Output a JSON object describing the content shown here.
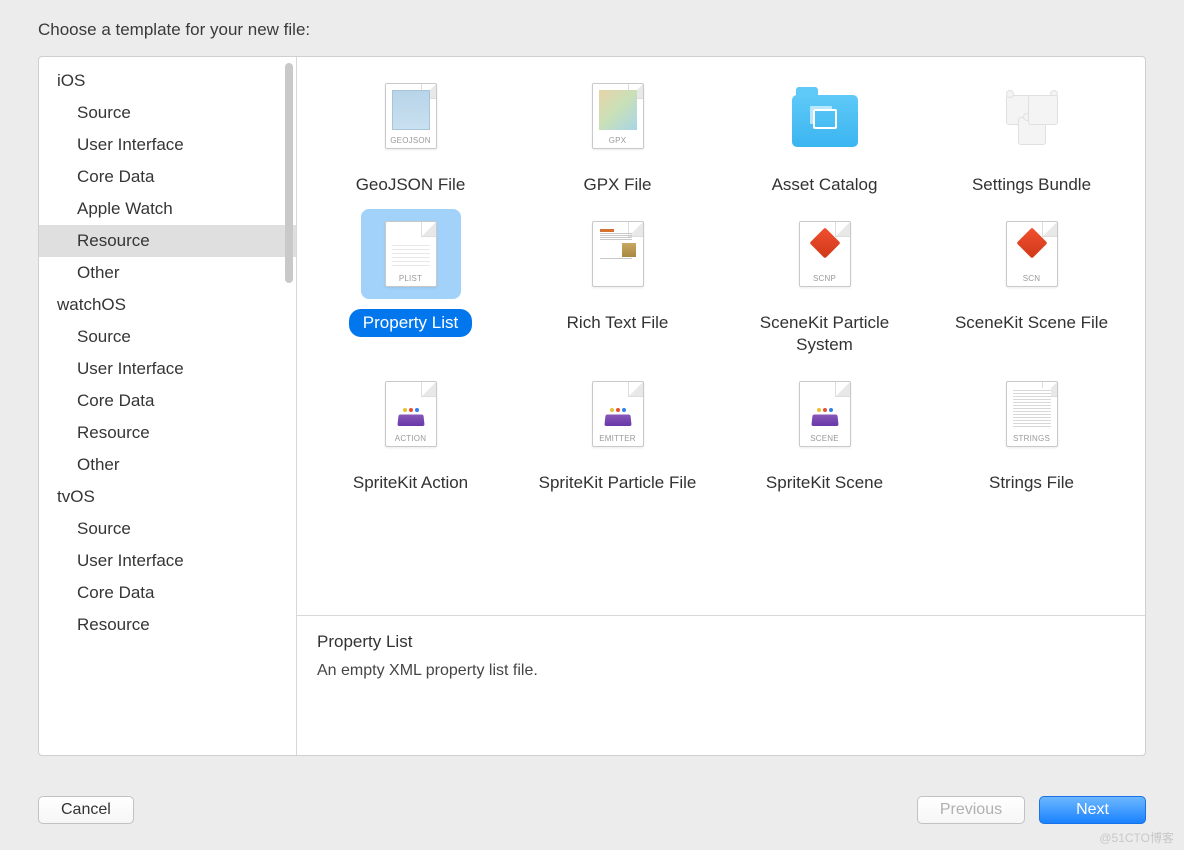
{
  "title": "Choose a template for your new file:",
  "sidebar": [
    {
      "type": "head",
      "label": "iOS"
    },
    {
      "type": "item",
      "label": "Source"
    },
    {
      "type": "item",
      "label": "User Interface"
    },
    {
      "type": "item",
      "label": "Core Data"
    },
    {
      "type": "item",
      "label": "Apple Watch"
    },
    {
      "type": "item",
      "label": "Resource",
      "selected": true
    },
    {
      "type": "item",
      "label": "Other"
    },
    {
      "type": "head",
      "label": "watchOS"
    },
    {
      "type": "item",
      "label": "Source"
    },
    {
      "type": "item",
      "label": "User Interface"
    },
    {
      "type": "item",
      "label": "Core Data"
    },
    {
      "type": "item",
      "label": "Resource"
    },
    {
      "type": "item",
      "label": "Other"
    },
    {
      "type": "head",
      "label": "tvOS"
    },
    {
      "type": "item",
      "label": "Source"
    },
    {
      "type": "item",
      "label": "User Interface"
    },
    {
      "type": "item",
      "label": "Core Data"
    },
    {
      "type": "item",
      "label": "Resource"
    }
  ],
  "templates": {
    "r0": [
      {
        "label": "GeoJSON File",
        "tag": "GEOJSON",
        "icon": "geo"
      },
      {
        "label": "GPX File",
        "tag": "GPX",
        "icon": "gpx"
      },
      {
        "label": "Asset Catalog",
        "icon": "folder"
      },
      {
        "label": "Settings Bundle",
        "icon": "lego"
      }
    ],
    "r1": [
      {
        "label": "Property List",
        "tag": "PLIST",
        "icon": "plist",
        "selected": true
      },
      {
        "label": "Rich Text File",
        "icon": "rtf"
      },
      {
        "label": "SceneKit Particle System",
        "tag": "SCNP",
        "icon": "scn"
      },
      {
        "label": "SceneKit Scene File",
        "tag": "SCN",
        "icon": "scn"
      }
    ],
    "r2": [
      {
        "label": "SpriteKit Action",
        "tag": "ACTION",
        "icon": "sk"
      },
      {
        "label": "SpriteKit Particle File",
        "tag": "EMITTER",
        "icon": "sk"
      },
      {
        "label": "SpriteKit Scene",
        "tag": "SCENE",
        "icon": "sk"
      },
      {
        "label": "Strings File",
        "tag": "STRINGS",
        "icon": "str"
      }
    ]
  },
  "description": {
    "title": "Property List",
    "body": "An empty XML property list file."
  },
  "buttons": {
    "cancel": "Cancel",
    "previous": "Previous",
    "next": "Next"
  },
  "watermark": "@51CTO博客"
}
